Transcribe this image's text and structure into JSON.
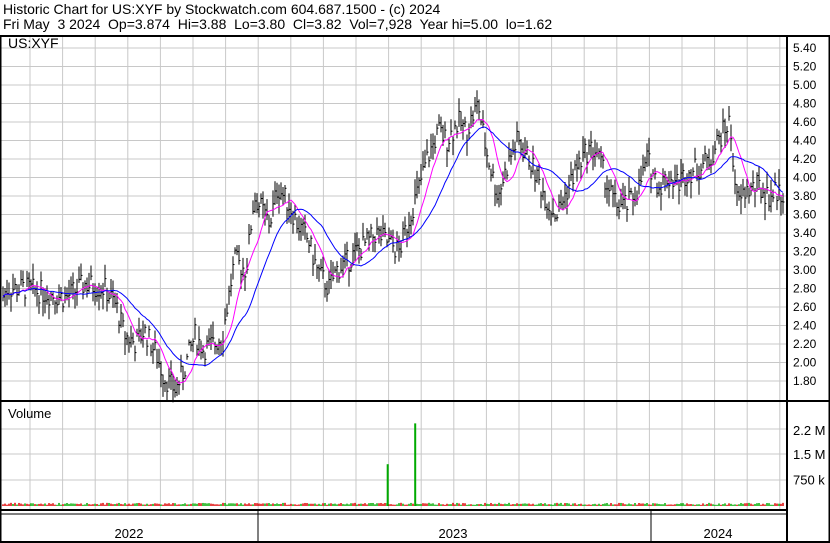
{
  "header": {
    "line1": "Historic Chart for US:XYF by Stockwatch.com 604.687.1500 - (c) 2024",
    "line2": "Fri May  3 2024  Op=3.874  Hi=3.88  Lo=3.80  Cl=3.82  Vol=7,928  Year hi=5.00  lo=1.62"
  },
  "chart_data": {
    "type": "line",
    "title": "US:XYF",
    "volume_title": "Volume",
    "price_ticks": [
      "5.40",
      "5.20",
      "5.00",
      "4.80",
      "4.60",
      "4.40",
      "4.20",
      "4.00",
      "3.80",
      "3.60",
      "3.40",
      "3.20",
      "3.00",
      "2.80",
      "2.60",
      "2.40",
      "2.20",
      "2.00",
      "1.80"
    ],
    "volume_ticks": [
      {
        "label": "2.2 M",
        "value": 2200000
      },
      {
        "label": "1.5 M",
        "value": 1500000
      },
      {
        "label": "750 k",
        "value": 750000
      }
    ],
    "year_labels": [
      "2022",
      "2023",
      "2024"
    ],
    "ylim": [
      1.6,
      5.5
    ],
    "x": [
      2022.33,
      2022.36,
      2022.41,
      2022.46,
      2022.51,
      2022.56,
      2022.61,
      2022.64,
      2022.66,
      2022.69,
      2022.71,
      2022.74,
      2022.76,
      2022.79,
      2022.81,
      2022.84,
      2022.86,
      2022.89,
      2022.91,
      2022.94,
      2022.97,
      2022.99,
      2023.03,
      2023.05,
      2023.08,
      2023.1,
      2023.13,
      2023.15,
      2023.18,
      2023.2,
      2023.23,
      2023.25,
      2023.28,
      2023.3,
      2023.33,
      2023.36,
      2023.38,
      2023.41,
      2023.43,
      2023.46,
      2023.48,
      2023.51,
      2023.53,
      2023.56,
      2023.58,
      2023.61,
      2023.64,
      2023.66,
      2023.69,
      2023.71,
      2023.74,
      2023.76,
      2023.79,
      2023.81,
      2023.84,
      2023.86,
      2023.89,
      2023.91,
      2023.94,
      2023.97,
      2023.99,
      2024.02,
      2024.04,
      2024.07,
      2024.09,
      2024.12,
      2024.15,
      2024.17,
      2024.2,
      2024.22,
      2024.24,
      2024.27,
      2024.3,
      2024.32,
      2024.34
    ],
    "close": [
      2.5,
      2.8,
      2.8,
      2.75,
      2.7,
      2.85,
      2.8,
      2.6,
      2.3,
      2.2,
      2.35,
      2.1,
      1.85,
      1.7,
      1.9,
      2.3,
      2.15,
      2.2,
      2.3,
      3.1,
      3.0,
      3.8,
      3.5,
      3.9,
      3.7,
      3.5,
      3.3,
      3.0,
      2.8,
      3.0,
      3.1,
      3.2,
      3.3,
      3.4,
      3.3,
      3.2,
      3.5,
      3.9,
      4.2,
      4.5,
      4.4,
      4.6,
      4.5,
      4.8,
      4.3,
      3.8,
      4.2,
      4.4,
      4.2,
      4.0,
      3.7,
      3.6,
      3.9,
      4.1,
      4.3,
      4.3,
      3.9,
      3.7,
      3.7,
      3.9,
      4.2,
      3.9,
      4.0,
      3.95,
      4.05,
      4.1,
      4.2,
      4.4,
      4.6,
      3.7,
      3.85,
      3.9,
      3.8,
      3.85,
      3.82
    ],
    "volume_spikes": [
      {
        "x": 2023.33,
        "value": 1200000
      },
      {
        "x": 2023.4,
        "value": 2400000
      }
    ],
    "colors": {
      "price": "#000000",
      "ma_short": "#ff00ff",
      "ma_long": "#0000ff",
      "vol_up": "#00aa00",
      "vol_down": "#dd0000",
      "grid": "#c8c8c8"
    }
  }
}
